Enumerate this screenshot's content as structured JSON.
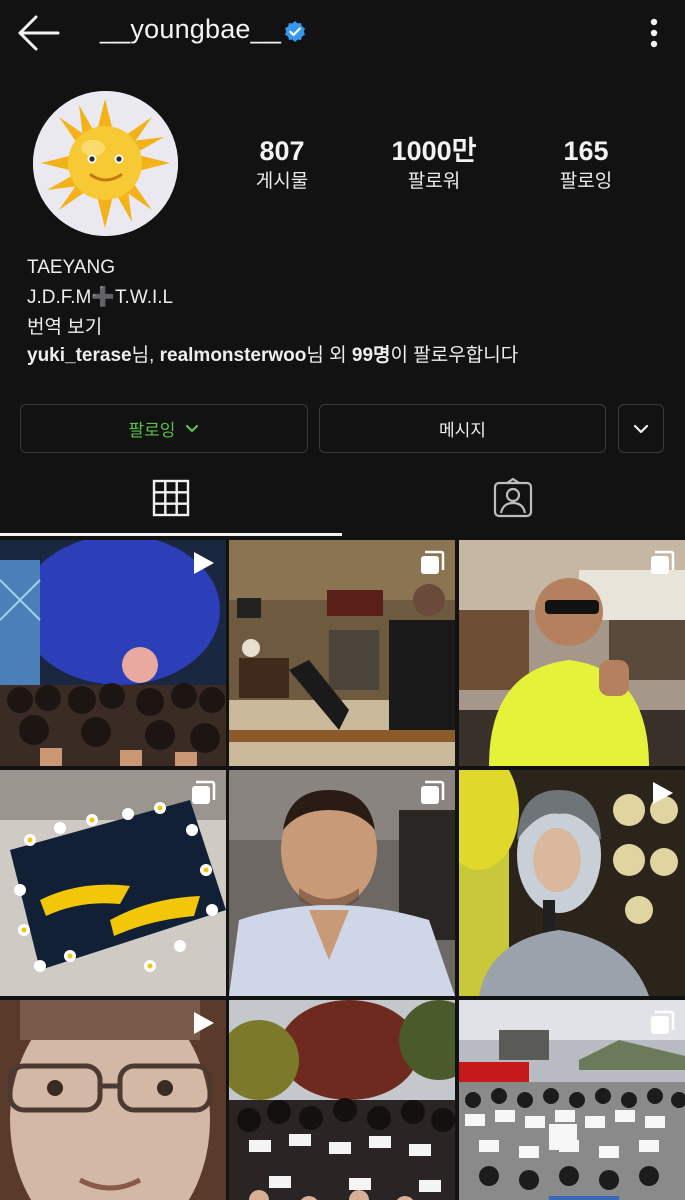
{
  "header": {
    "username": "__youngbae__",
    "back_icon": "arrow-left-icon",
    "verified_icon": "verified-badge-icon",
    "verified_color": "#3897f0",
    "more_icon": "vertical-dots-icon"
  },
  "profile": {
    "stats": [
      {
        "value": "807",
        "label": "게시물"
      },
      {
        "value": "1000만",
        "label": "팔로워"
      },
      {
        "value": "165",
        "label": "팔로잉"
      }
    ],
    "name": "TAEYANG",
    "bio_line": "J.D.F.M➕T.W.I.L",
    "translate": "번역 보기",
    "followed_by": {
      "user1": "yuki_terase",
      "sep1": "님, ",
      "user2": "realmonsterwoo",
      "sep2": "님 외 ",
      "count": "99명",
      "tail": "이 팔로우합니다"
    }
  },
  "actions": {
    "following_label": "팔로잉",
    "following_color": "#58c24a",
    "message_label": "메시지"
  },
  "tabs": [
    {
      "icon": "grid-icon",
      "active": true
    },
    {
      "icon": "tagged-person-icon",
      "active": false
    }
  ],
  "posts": [
    {
      "badge": "play-icon"
    },
    {
      "badge": "carousel-icon"
    },
    {
      "badge": "carousel-icon"
    },
    {
      "badge": "carousel-icon"
    },
    {
      "badge": "carousel-icon"
    },
    {
      "badge": "play-icon"
    },
    {
      "badge": "play-icon"
    },
    {
      "badge": ""
    },
    {
      "badge": "carousel-icon"
    }
  ]
}
